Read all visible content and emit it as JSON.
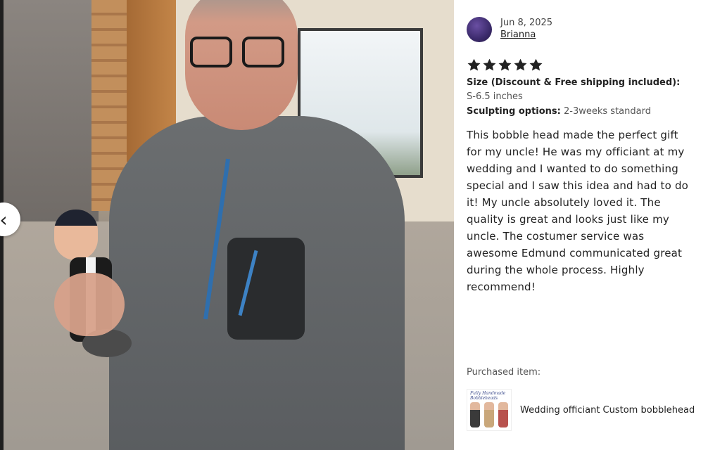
{
  "review": {
    "date": "Jun 8, 2025",
    "reviewer": "Brianna",
    "rating": 5,
    "max_rating": 5,
    "variations": [
      {
        "label": "Size (Discount & Free shipping included):",
        "value": "S-6.5 inches"
      },
      {
        "label": "Sculpting options:",
        "value": "2-3weeks standard"
      }
    ],
    "text": "This bobble head made the perfect gift for my uncle! He was my officiant at my wedding and I wanted to do something special and I saw this idea and had to do it! My uncle absolutely loved it. The quality is great and looks just like my uncle. The costumer service was awesome Edmund communicated great during the whole process. Highly recommend!"
  },
  "purchased": {
    "label": "Purchased item:",
    "title": "Wedding officiant Custom bobblehead",
    "thumb_text": "Fully Handmade Bobbleheads"
  },
  "nav": {
    "prev_icon": "chevron-left-icon",
    "next_icon": "chevron-right-icon"
  },
  "colors": {
    "panel_bg": "#ffffff",
    "star": "#222222",
    "backdrop": "#1f1f1f"
  }
}
